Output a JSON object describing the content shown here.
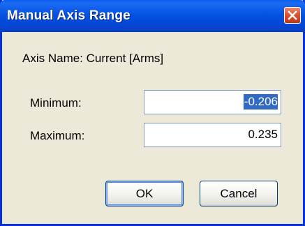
{
  "window": {
    "title": "Manual Axis Range"
  },
  "dialog": {
    "axis_name": "Axis Name: Current [Arms]",
    "minimum_label": "Minimum:",
    "minimum_value": "-0.206",
    "maximum_label": "Maximum:",
    "maximum_value": "0.235",
    "ok_label": "OK",
    "cancel_label": "Cancel"
  },
  "icons": {
    "close": "close-icon"
  },
  "colors": {
    "title_bar": "#0553E3",
    "close_button": "#D9502B",
    "dialog_background": "#ECE9D8",
    "selection": "#316AC5"
  }
}
